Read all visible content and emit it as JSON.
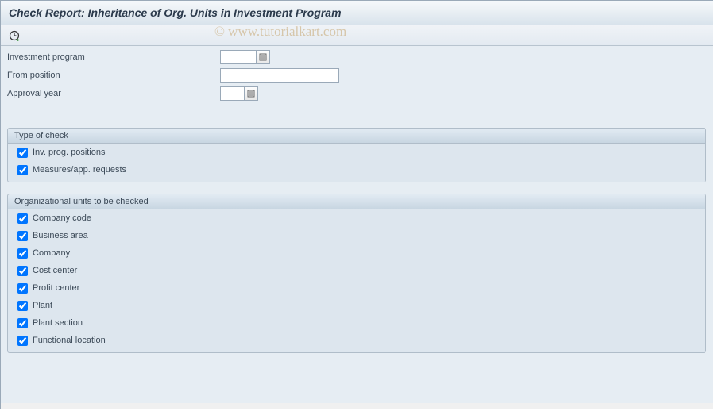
{
  "title": "Check Report: Inheritance of Org. Units in Investment Program",
  "watermark": "© www.tutorialkart.com",
  "fields": {
    "investment_program": {
      "label": "Investment program",
      "value": ""
    },
    "from_position": {
      "label": "From position",
      "value": ""
    },
    "approval_year": {
      "label": "Approval year",
      "value": ""
    }
  },
  "group1": {
    "title": "Type of check",
    "items": [
      {
        "label": "Inv. prog. positions",
        "checked": true
      },
      {
        "label": "Measures/app. requests",
        "checked": true
      }
    ]
  },
  "group2": {
    "title": "Organizational units to be checked",
    "items": [
      {
        "label": "Company code",
        "checked": true
      },
      {
        "label": "Business area",
        "checked": true
      },
      {
        "label": "Company",
        "checked": true
      },
      {
        "label": "Cost center",
        "checked": true
      },
      {
        "label": "Profit center",
        "checked": true
      },
      {
        "label": "Plant",
        "checked": true
      },
      {
        "label": "Plant section",
        "checked": true
      },
      {
        "label": "Functional location",
        "checked": true
      }
    ]
  }
}
